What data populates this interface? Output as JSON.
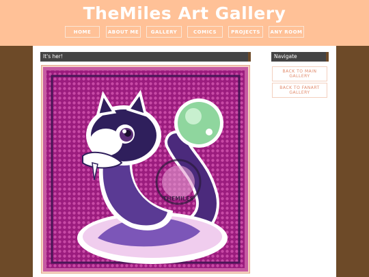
{
  "site": {
    "title": "TheMiles Art Gallery"
  },
  "nav": {
    "items": [
      {
        "label": "HOME"
      },
      {
        "label": "ABOUT ME"
      },
      {
        "label": "GALLERY"
      },
      {
        "label": "COMICS"
      },
      {
        "label": "PROJECTS"
      },
      {
        "label": "ANY ROOM"
      }
    ]
  },
  "main": {
    "post_title": "It's her!",
    "artwork": {
      "watermark": "THEMILES"
    }
  },
  "sidebar": {
    "heading": "Navigate",
    "buttons": [
      {
        "label": "BACK TO MAIN GALLERY"
      },
      {
        "label": "BACK TO FANART GALLERY"
      }
    ]
  },
  "colors": {
    "header_bg": "#ffc197",
    "page_bg": "#6d4a28",
    "bar_bg": "#444444",
    "accent": "#e0896a"
  }
}
